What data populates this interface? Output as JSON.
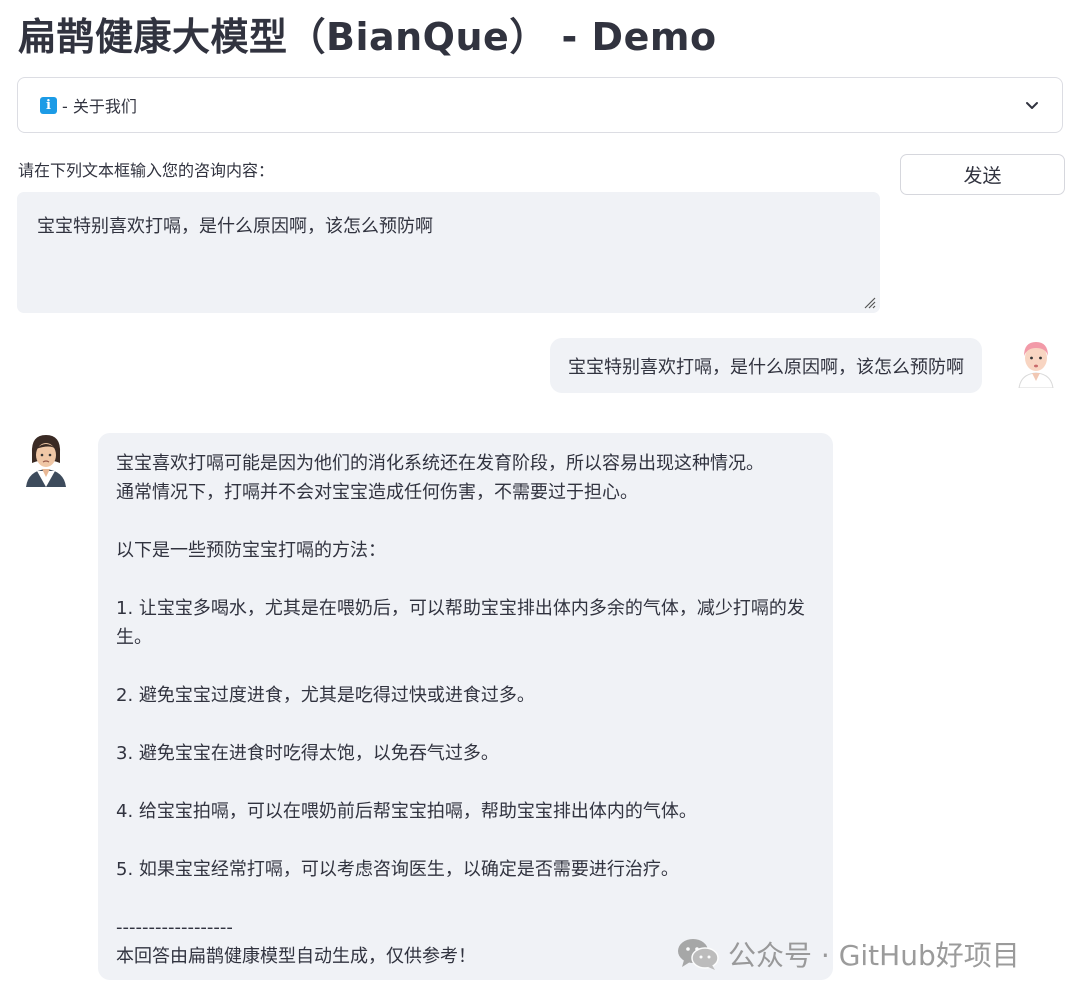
{
  "page": {
    "title": "扁鹊健康大模型（BianQue） - Demo"
  },
  "expander": {
    "icon": "info-icon",
    "label": "- 关于我们",
    "expanded": false
  },
  "input": {
    "label": "请在下列文本框输入您的咨询内容：",
    "value": "宝宝特别喜欢打嗝，是什么原因啊，该怎么预防啊",
    "send_label": "发送"
  },
  "chat": {
    "user_message": "宝宝特别喜欢打嗝，是什么原因啊，该怎么预防啊",
    "bot_reply": {
      "intro_1": "宝宝喜欢打嗝可能是因为他们的消化系统还在发育阶段，所以容易出现这种情况。",
      "intro_2": "通常情况下，打嗝并不会对宝宝造成任何伤害，不需要过于担心。",
      "lead": "以下是一些预防宝宝打嗝的方法：",
      "items": [
        "1. 让宝宝多喝水，尤其是在喂奶后，可以帮助宝宝排出体内多余的气体，减少打嗝的发生。",
        "2. 避免宝宝过度进食，尤其是吃得过快或进食过多。",
        "3. 避免宝宝在进食时吃得太饱，以免吞气过多。",
        "4. 给宝宝拍嗝，可以在喂奶前后帮宝宝拍嗝，帮助宝宝排出体内的气体。",
        "5. 如果宝宝经常打嗝，可以考虑咨询医生，以确定是否需要进行治疗。"
      ],
      "divider": "------------------",
      "disclaimer": "本回答由扁鹊健康模型自动生成，仅供参考！"
    }
  },
  "watermark": {
    "icon": "wechat-icon",
    "text": "公众号 · GitHub好项目"
  },
  "colors": {
    "bubble": "#f0f2f6",
    "info": "#1c9be6",
    "text": "#31333f"
  }
}
